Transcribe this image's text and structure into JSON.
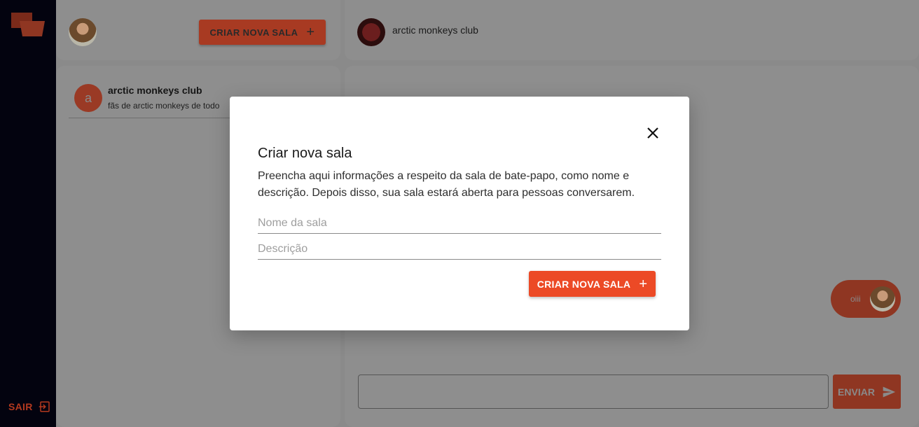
{
  "nav": {
    "logout_label": "SAIR"
  },
  "sidebar_header": {
    "create_room_label": "CRIAR NOVA SALA"
  },
  "chat_header": {
    "room_name": "arctic monkeys club"
  },
  "rooms": [
    {
      "letter": "a",
      "name": "arctic monkeys club",
      "description": "fãs de arctic monkeys de todo"
    }
  ],
  "messages": [
    {
      "text": "oiii"
    }
  ],
  "composer": {
    "send_label": "ENVIAR"
  },
  "modal": {
    "title": "Criar nova sala",
    "description": "Preencha aqui informações a respeito da sala de bate-papo, como nome e descrição. Depois disso, sua sala estará aberta para pessoas conversarem.",
    "name_placeholder": "Nome da sala",
    "description_placeholder": "Descrição",
    "create_label": "CRIAR NOVA SALA"
  },
  "colors": {
    "accent": "#ec4a26",
    "nav_bg": "#03030f",
    "overlay_grey": "#8a8a8a"
  }
}
